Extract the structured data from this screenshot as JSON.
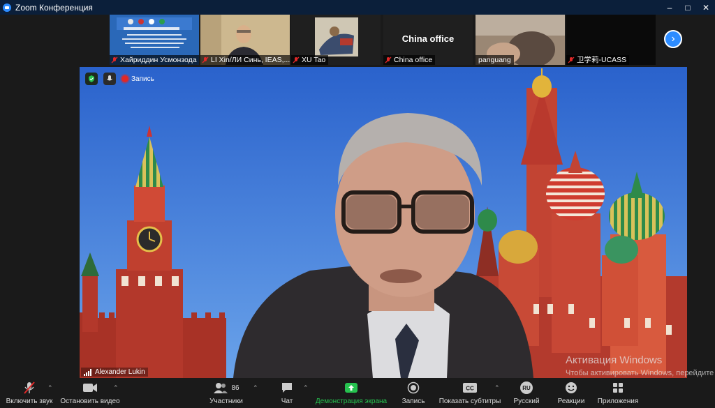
{
  "window": {
    "title": "Zoom Конференция"
  },
  "thumbnails": [
    {
      "name": "Хайриддин Усмонзода"
    },
    {
      "name": "LI Xin/ЛИ Синь, IEAS,..."
    },
    {
      "name": "XU Tao"
    },
    {
      "name": "China office",
      "center_text": "China office"
    },
    {
      "name": "panguang"
    },
    {
      "name": "卫学莉-UCASS"
    }
  ],
  "main": {
    "recording_label": "Запись",
    "speaker_name": "Alexander Lukin"
  },
  "activation": {
    "title": "Активация Windows",
    "subtitle": "Чтобы активировать Windows, перейдите в раздел \"Параметры\"."
  },
  "toolbar": {
    "mute": "Включить звук",
    "video": "Остановить видео",
    "participants": "Участники",
    "participants_count": "86",
    "chat": "Чат",
    "share": "Демонстрация экрана",
    "record": "Запись",
    "captions": "Показать субтитры",
    "language": "Русский",
    "language_code": "RU",
    "reactions": "Реакции",
    "apps": "Приложения"
  },
  "colors": {
    "accent": "#2d8cff",
    "share_green": "#26c24f",
    "muted_red": "#e02828"
  }
}
